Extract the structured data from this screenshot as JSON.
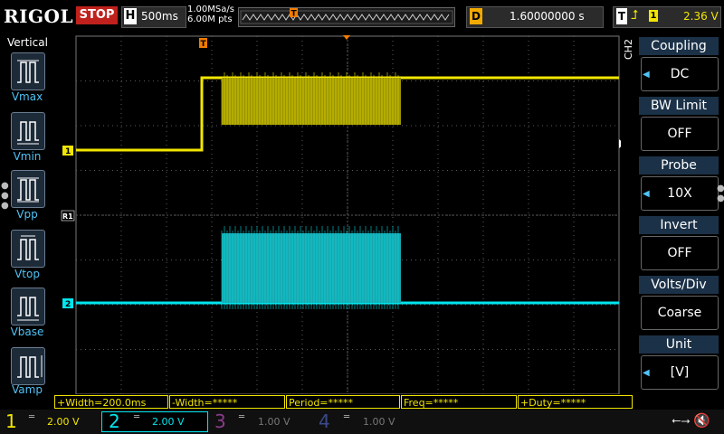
{
  "topbar": {
    "brand": "RIGOL",
    "run_state": "STOP",
    "horizontal_letter": "H",
    "timebase": "500ms",
    "sample_rate": "1.00MSa/s",
    "memory_depth": "6.00M pts",
    "trigger_marker": "T",
    "delay_letter": "D",
    "delay": "1.60000000 s",
    "trigger_letter": "T",
    "trigger_edge": "⮥",
    "trigger_channel": "1",
    "trigger_level": "2.36 V"
  },
  "left_panel": {
    "title": "Vertical",
    "items": [
      {
        "label": "Vmax"
      },
      {
        "label": "Vmin"
      },
      {
        "label": "Vpp"
      },
      {
        "label": "Vtop"
      },
      {
        "label": "Vbase"
      },
      {
        "label": "Vamp"
      }
    ]
  },
  "screen": {
    "ch1_marker": "1",
    "ch2_marker": "2",
    "trigger_ref_marker": "R1",
    "trigger_pos_marker": "T"
  },
  "right_panel": {
    "channel": "CH2",
    "items": [
      {
        "title": "Coupling",
        "value": "DC",
        "has_arrow": true
      },
      {
        "title": "BW Limit",
        "value": "OFF",
        "has_arrow": false
      },
      {
        "title": "Probe",
        "value": "10X",
        "has_arrow": true
      },
      {
        "title": "Invert",
        "value": "OFF",
        "has_arrow": false
      },
      {
        "title": "Volts/Div",
        "value": "Coarse",
        "has_arrow": false
      },
      {
        "title": "Unit",
        "value": "[V]",
        "has_arrow": true
      }
    ]
  },
  "measurements": [
    "+Width=200.0ms",
    "-Width=*****",
    "Period=*****",
    "Freq=*****",
    "+Duty=*****"
  ],
  "channels": [
    {
      "num": "1",
      "scale": "2.00 V",
      "color": "#f2e600"
    },
    {
      "num": "2",
      "scale": "2.00 V",
      "color": "#00e5ee"
    },
    {
      "num": "3",
      "scale": "1.00 V",
      "color": "#8a3c8a"
    },
    {
      "num": "4",
      "scale": "1.00 V",
      "color": "#3a4a8a"
    }
  ],
  "colors": {
    "ch1": "#f2e600",
    "ch2": "#00e5ee",
    "grid": "#5a5a5a",
    "trigger": "#f27c00"
  }
}
